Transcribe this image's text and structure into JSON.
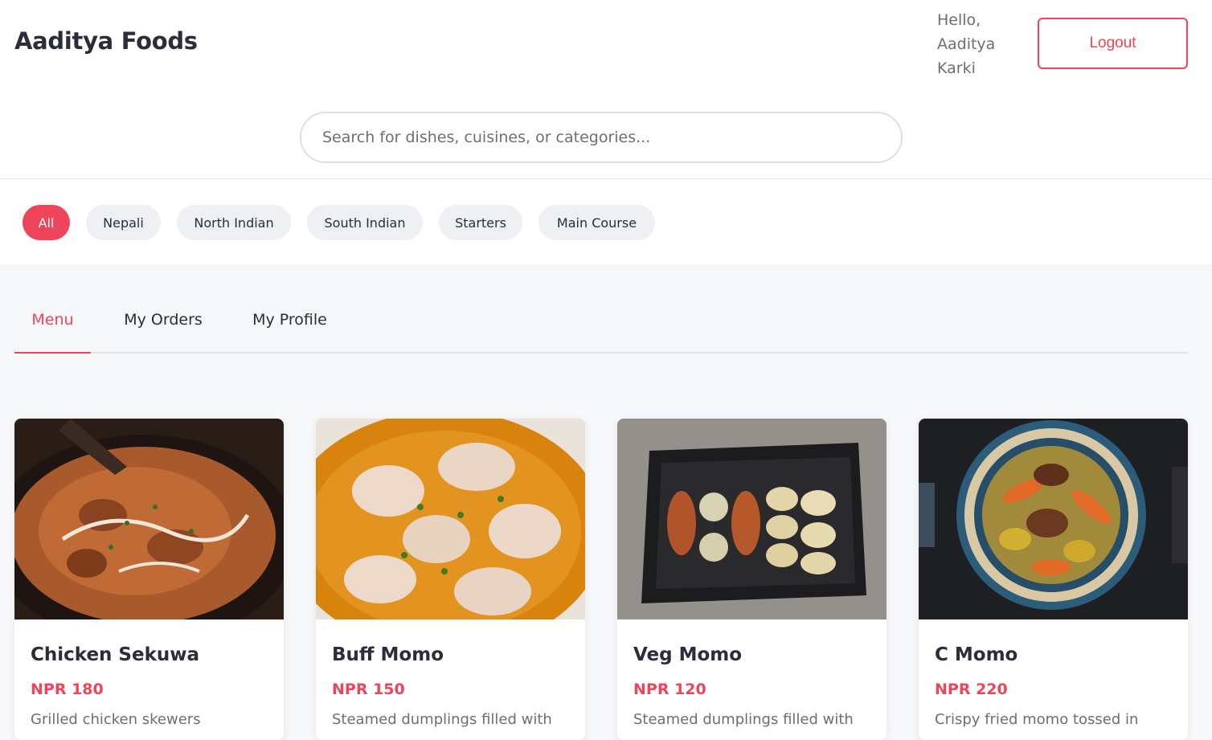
{
  "header": {
    "brand": "Aaditya Foods",
    "greeting": "Hello, Aaditya Karki",
    "logout_label": "Logout"
  },
  "search": {
    "placeholder": "Search for dishes, cuisines, or categories..."
  },
  "filters": {
    "items": [
      "All",
      "Nepali",
      "North Indian",
      "South Indian",
      "Starters",
      "Main Course"
    ],
    "active": "All"
  },
  "tabs": {
    "items": [
      "Menu",
      "My Orders",
      "My Profile"
    ],
    "active": "Menu"
  },
  "dishes": [
    {
      "name": "Chicken Sekuwa",
      "price": "NPR 180",
      "description": "Grilled chicken skewers"
    },
    {
      "name": "Buff Momo",
      "price": "NPR 150",
      "description": "Steamed dumplings filled with"
    },
    {
      "name": "Veg Momo",
      "price": "NPR 120",
      "description": "Steamed dumplings filled with"
    },
    {
      "name": "C Momo",
      "price": "NPR 220",
      "description": "Crispy fried momo tossed in"
    }
  ],
  "colors": {
    "accent": "#f0445a",
    "text": "#2b2d3a",
    "muted": "#6b6e78",
    "chip": "#eef0f3"
  }
}
